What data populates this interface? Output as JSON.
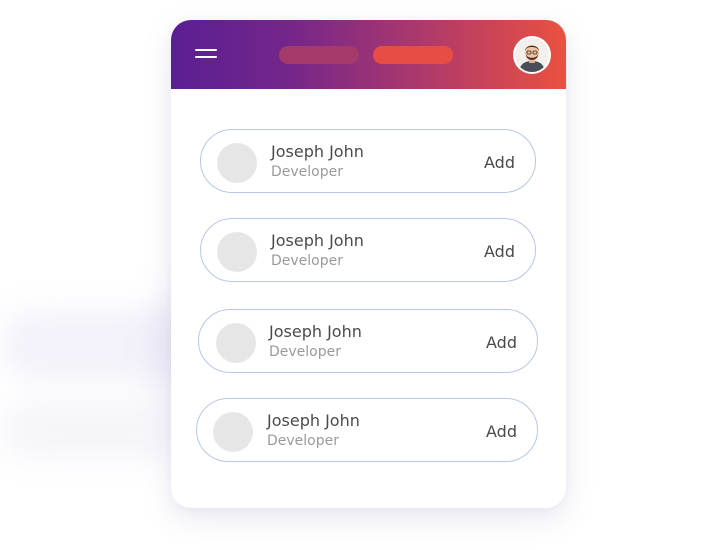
{
  "header": {
    "menu_icon": "hamburger-menu-icon",
    "avatar_icon": "user-avatar-icon",
    "gradient": [
      "#5a1f93",
      "#ea5140"
    ]
  },
  "contacts": [
    {
      "name": "Joseph John",
      "role": "Developer",
      "action": "Add"
    },
    {
      "name": "Joseph John",
      "role": "Developer",
      "action": "Add"
    },
    {
      "name": "Joseph John",
      "role": "Developer",
      "action": "Add"
    },
    {
      "name": "Joseph John",
      "role": "Developer",
      "action": "Add"
    }
  ]
}
